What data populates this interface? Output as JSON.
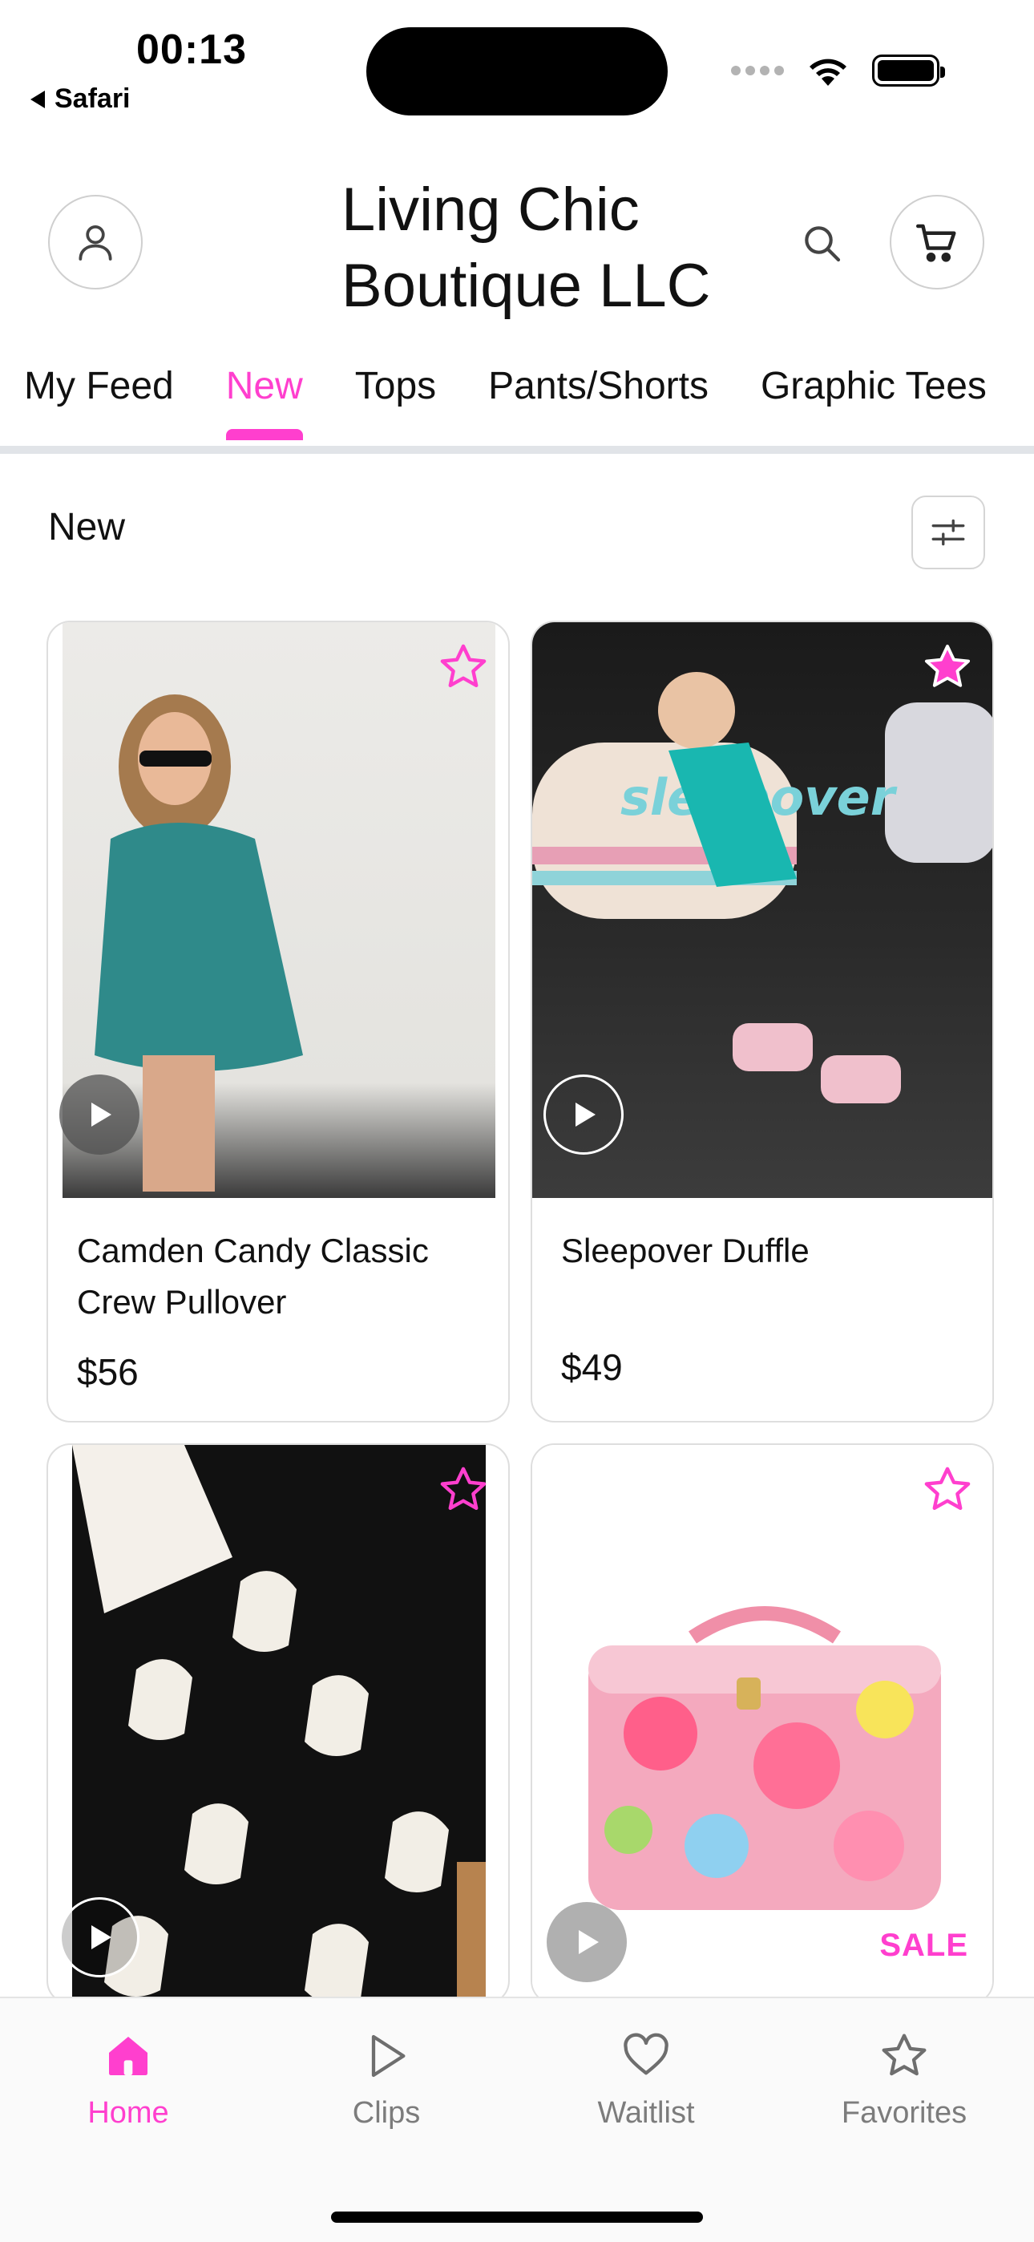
{
  "status_bar": {
    "time": "00:13",
    "back_app": "Safari"
  },
  "header": {
    "store_name": "Living Chic Boutique LLC"
  },
  "tabs": [
    {
      "label": "My Feed",
      "active": false
    },
    {
      "label": "New",
      "active": true
    },
    {
      "label": "Tops",
      "active": false
    },
    {
      "label": "Pants/Shorts",
      "active": false
    },
    {
      "label": "Graphic Tees",
      "active": false
    }
  ],
  "section": {
    "title": "New"
  },
  "products": [
    {
      "name": "Camden Candy Classic Crew Pullover",
      "price": "$56",
      "has_video": true,
      "favorited": false
    },
    {
      "name": "Sleepover Duffle",
      "price": "$49",
      "has_video": true,
      "favorited": true
    },
    {
      "name": "",
      "price": "",
      "has_video": true,
      "favorited": false
    },
    {
      "name": "",
      "price": "",
      "has_video": true,
      "favorited": false,
      "badge": "SALE"
    }
  ],
  "bottom_nav": [
    {
      "label": "Home",
      "icon": "home-icon",
      "active": true
    },
    {
      "label": "Clips",
      "icon": "play-icon",
      "active": false
    },
    {
      "label": "Waitlist",
      "icon": "heart-icon",
      "active": false
    },
    {
      "label": "Favorites",
      "icon": "star-icon",
      "active": false
    }
  ],
  "colors": {
    "accent": "#ff3fce",
    "text": "#111111",
    "muted": "#7c7c7c",
    "divider": "#e1e4e8"
  }
}
